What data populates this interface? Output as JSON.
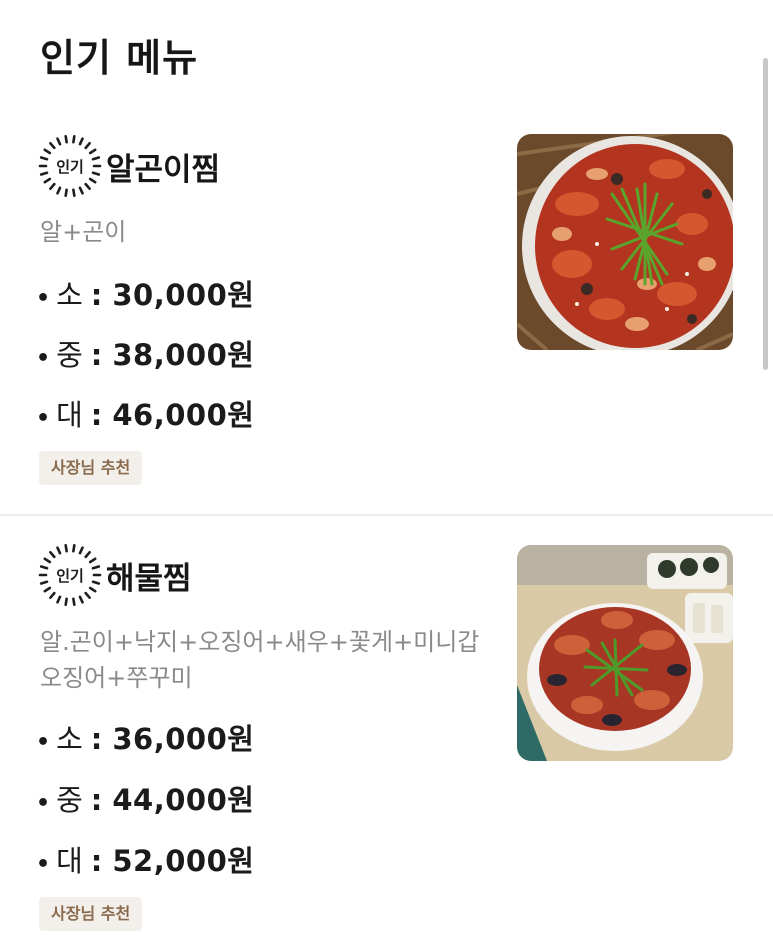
{
  "header": {
    "title": "인기 메뉴"
  },
  "menu_items": [
    {
      "badge": "인기",
      "name": "알곤이찜",
      "description_lines": [
        "알+곤이"
      ],
      "prices": [
        {
          "size": "소",
          "price": "30,000원"
        },
        {
          "size": "중",
          "price": "38,000원"
        },
        {
          "size": "대",
          "price": "46,000원"
        }
      ],
      "recommendation": "사장님 추천"
    },
    {
      "badge": "인기",
      "name": "해물찜",
      "description_lines": [
        "알.곤이+낙지+오징어+새우+꽃게+미니갑",
        "오징어+쭈꾸미"
      ],
      "prices": [
        {
          "size": "소",
          "price": "36,000원"
        },
        {
          "size": "중",
          "price": "44,000원"
        },
        {
          "size": "대",
          "price": "52,000원"
        }
      ],
      "recommendation": "사장님 추천"
    }
  ],
  "icons": {
    "badge_icon": "sunburst-badge-icon"
  },
  "colors": {
    "recommend_bg": "#f3efea",
    "recommend_text": "#8a6b4e",
    "description": "#8a8a8a"
  }
}
